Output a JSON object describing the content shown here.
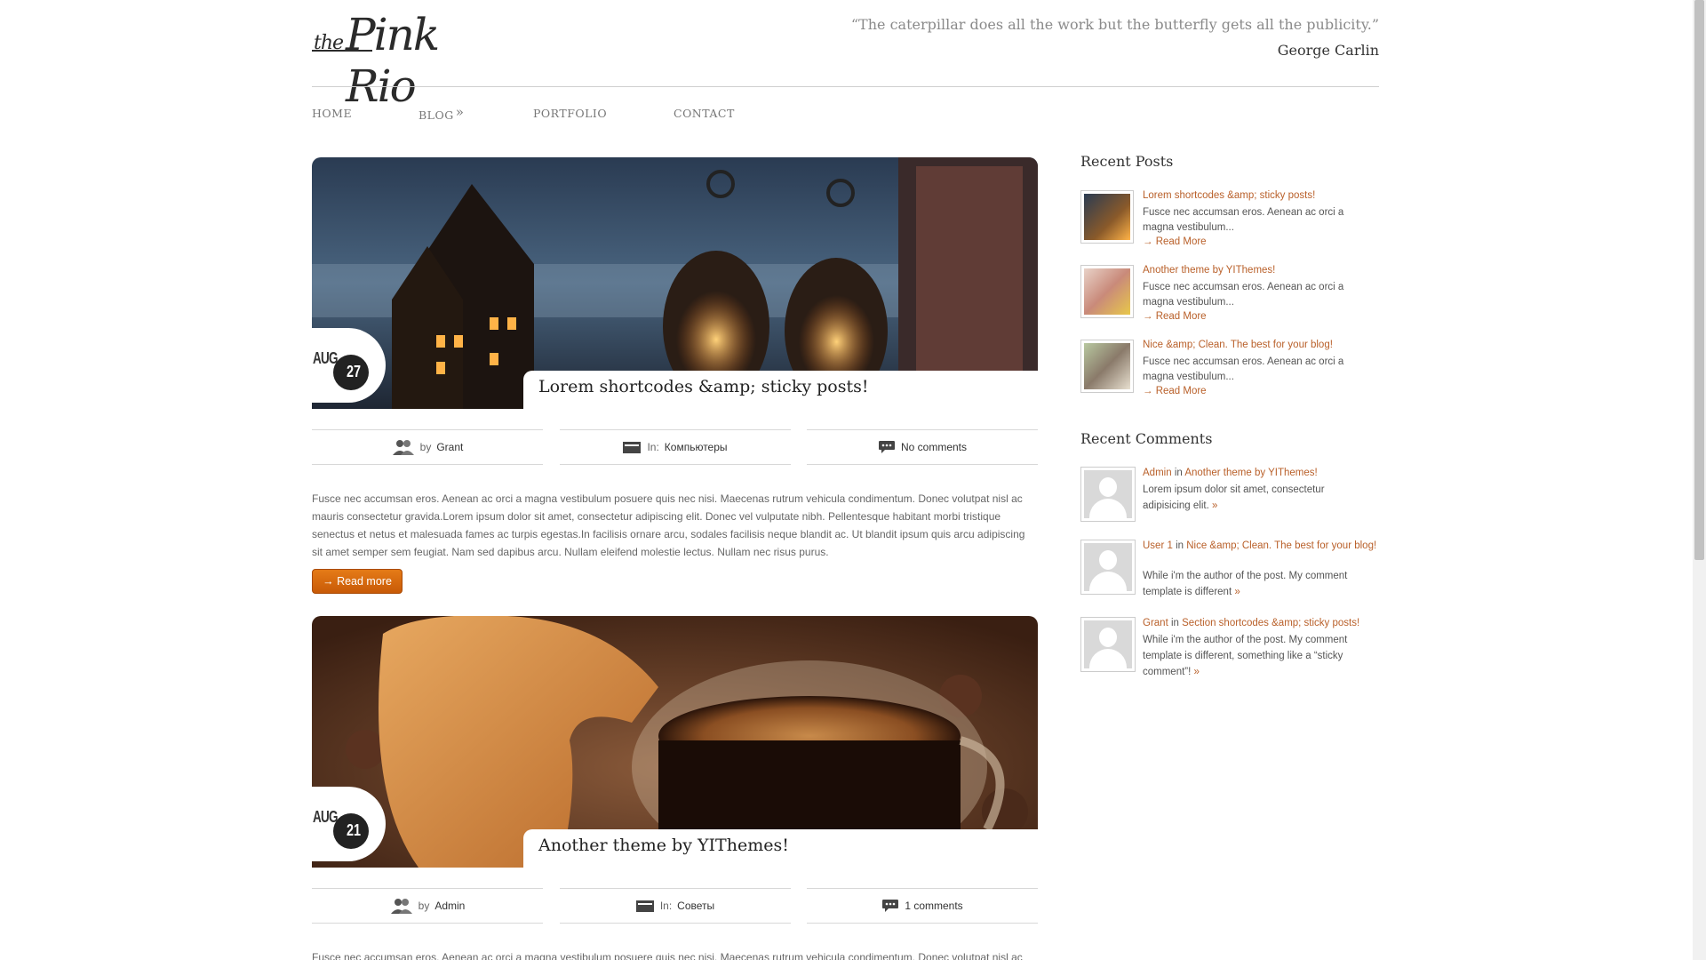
{
  "site": {
    "logo_the": "the",
    "logo_name": "Pink Rio",
    "quote": "“The caterpillar does all the work but the butterfly gets all the publicity.”",
    "quote_author": "George Carlin"
  },
  "nav": {
    "home": "HOME",
    "blog": "BLOG",
    "blog_arrow": "»",
    "portfolio": "PORTFOLIO",
    "contact": "CONTACT"
  },
  "posts": [
    {
      "title": "Lorem shortcodes &amp; sticky posts!",
      "month": "AUG",
      "day": "27",
      "by_prefix": "by",
      "author": "Grant",
      "in_prefix": "In:",
      "category": "Компьютеры",
      "comments": "No comments",
      "excerpt": "Fusce nec accumsan eros. Aenean ac orci a magna vestibulum posuere quis nec nisi. Maecenas rutrum vehicula condimentum. Donec volutpat nisl ac mauris consectetur gravida.Lorem ipsum dolor sit amet, consectetur adipiscing elit. Donec vel vulputate nibh. Pellentesque habitant morbi tristique senectus et netus et malesuada fames ac turpis egestas.In facilisis ornare arcu, sodales facilisis neque blandit ac. Ut blandit ipsum quis arcu adipiscing sit amet semper sem feugiat. Nam sed dapibus arcu. Nullam eleifend molestie lectus. Nullam nec risus purus.",
      "read_more": "→ Read more"
    },
    {
      "title": "Another theme by YIThemes!",
      "month": "AUG",
      "day": "21",
      "by_prefix": "by",
      "author": "Admin",
      "in_prefix": "In:",
      "category": "Советы",
      "comments": "1 comments",
      "excerpt": "Fusce nec accumsan eros. Aenean ac orci a magna vestibulum posuere quis nec nisi. Maecenas rutrum vehicula condimentum. Donec volutpat nisl ac"
    }
  ],
  "sidebar": {
    "recent_posts_title": "Recent Posts",
    "recent_posts": [
      {
        "title": "Lorem shortcodes &amp; sticky posts!",
        "excerpt": "Fusce nec accumsan eros. Aenean ac orci a magna vestibulum...",
        "more": "→ Read More"
      },
      {
        "title": "Another theme by YIThemes!",
        "excerpt": "Fusce nec accumsan eros. Aenean ac orci a magna vestibulum...",
        "more": "→ Read More"
      },
      {
        "title": "Nice &amp; Clean. The best for your blog!",
        "excerpt": "Fusce nec accumsan eros. Aenean ac orci a magna vestibulum...",
        "more": "→ Read More"
      }
    ],
    "recent_comments_title": "Recent Comments",
    "recent_comments": [
      {
        "author": "Admin",
        "in": "in",
        "post": "Another theme by YIThemes!",
        "text": "Lorem ipsum dolor sit amet, consectetur adipisicing elit.",
        "more": "»"
      },
      {
        "author": "User 1",
        "in": "in",
        "post": "Nice &amp; Clean. The best for your blog!",
        "text": "While i'm the author of the post. My comment template is different",
        "more": "»"
      },
      {
        "author": "Grant",
        "in": "in",
        "post": "Section shortcodes &amp; sticky posts!",
        "text": "While i'm the author of the post. My comment template is different, something like a “sticky comment”!",
        "more": "»"
      }
    ]
  },
  "colors": {
    "accent": "#b9602a",
    "button": "#d76a0f",
    "text": "#555555"
  }
}
